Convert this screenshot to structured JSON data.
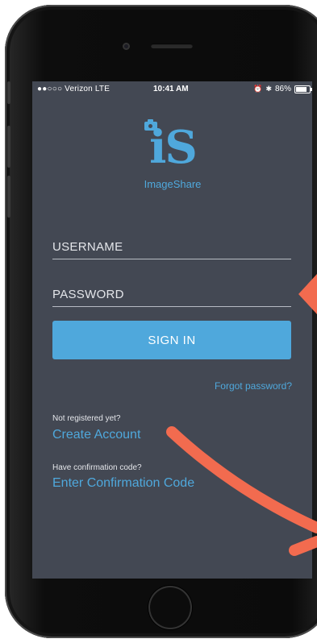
{
  "status_bar": {
    "carrier": "●●○○○ Verizon  LTE",
    "time": "10:41 AM",
    "battery": "86%"
  },
  "logo": {
    "mark": "iS",
    "name": "ImageShare"
  },
  "form": {
    "username_placeholder": "USERNAME",
    "password_placeholder": "PASSWORD",
    "sign_in_label": "SIGN IN",
    "forgot_password": "Forgot password?"
  },
  "register": {
    "prompt": "Not registered yet?",
    "link": "Create Account"
  },
  "confirm": {
    "prompt": "Have confirmation code?",
    "link": "Enter Confirmation Code"
  },
  "colors": {
    "accent": "#4fa8dc",
    "screen_bg": "#434853",
    "annotation": "#f26b4f"
  },
  "icons": [
    "camera-icon",
    "alarm-icon",
    "bluetooth-icon",
    "battery-icon"
  ]
}
